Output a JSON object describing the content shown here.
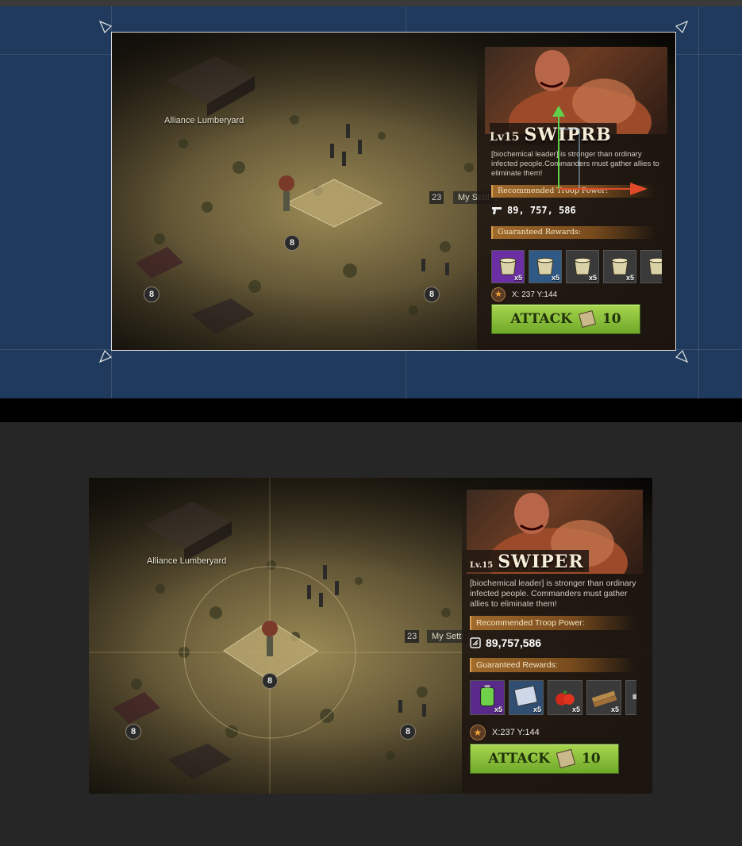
{
  "editor_preview": {
    "map": {
      "alliance_label": "Alliance Lumberyard",
      "target_level": "8",
      "left_level": "8",
      "right_level": "8",
      "settlement_num": "23",
      "settlement_label": "My Settl"
    },
    "boss": {
      "lv_label": "Lv15",
      "name": "SWIPRB",
      "description": "[biochemical leader] is stronger than ordinary infected people.Commanders must gather allies to eliminate them!",
      "power_title": "Recommended Troop Power:",
      "power_value": "89, 757, 586",
      "rewards_title": "Guaranteed Rewards:",
      "rewards": [
        {
          "icon": "bucket-icon",
          "qty": "x5",
          "bg": "#6b2fa3"
        },
        {
          "icon": "bucket-icon",
          "qty": "x5",
          "bg": "#2f5a86"
        },
        {
          "icon": "bucket-icon",
          "qty": "x5",
          "bg": "#3a3a3a"
        },
        {
          "icon": "bucket-icon",
          "qty": "x5",
          "bg": "#3a3a3a"
        },
        {
          "icon": "bucket-icon",
          "qty": "",
          "bg": "#3a3a3a"
        }
      ],
      "coords": "X:  237 Y:144",
      "attack_label": "ATTACK",
      "attack_cost": "10"
    }
  },
  "game_view": {
    "map": {
      "alliance_label": "Alliance Lumberyard",
      "target_level": "8",
      "left_level": "8",
      "right_level": "8",
      "settlement_num": "23",
      "settlement_label": "My Settl"
    },
    "boss": {
      "lv_label": "Lv.15",
      "name": "SWIPER",
      "description": "[biochemical leader] is stronger than ordinary infected people. Commanders must gather allies to eliminate them!",
      "power_title": "Recommended Troop Power:",
      "power_value": "89,757,586",
      "rewards_title": "Guaranteed Rewards:",
      "rewards": [
        {
          "icon": "battery-icon",
          "qty": "x5",
          "bg": "#5a2a8a"
        },
        {
          "icon": "blueprint-icon",
          "qty": "x5",
          "bg": "#2f4e72"
        },
        {
          "icon": "tomato-icon",
          "qty": "x5",
          "bg": "#3a3a3a"
        },
        {
          "icon": "wood-plank-icon",
          "qty": "x5",
          "bg": "#3a3a3a"
        },
        {
          "icon": "metal-icon",
          "qty": "",
          "bg": "#3a3a3a"
        }
      ],
      "coords": "X:237 Y:144",
      "attack_label": "ATTACK",
      "attack_cost": "10"
    }
  },
  "colors": {
    "editor_bg": "#1f3a5c",
    "attack_green": "#8fc43e",
    "section_brown": "#a06a2b",
    "frame_bg": "#181612"
  }
}
